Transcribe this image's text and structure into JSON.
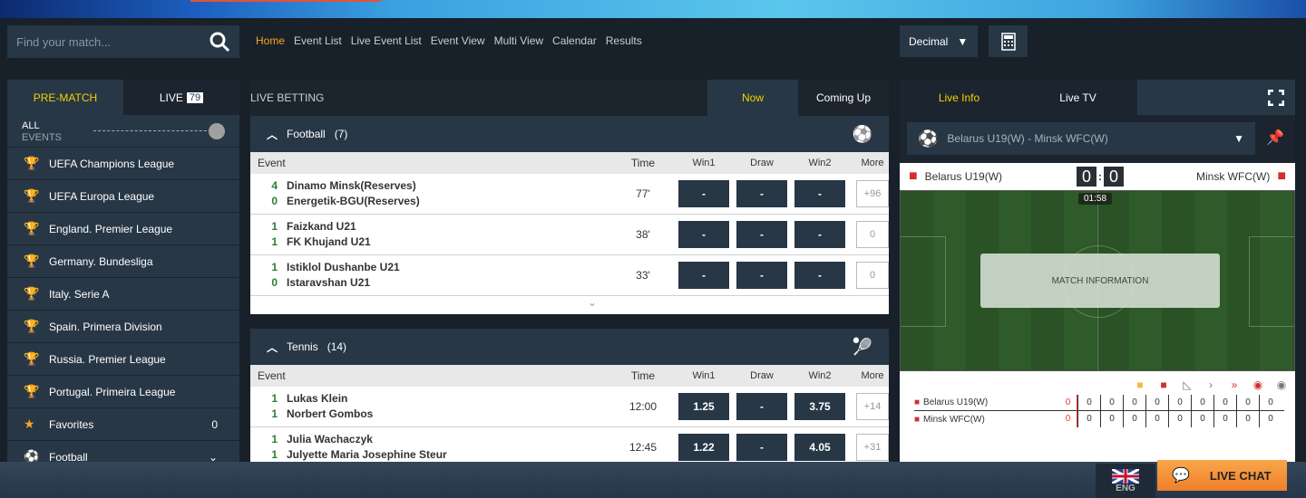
{
  "search": {
    "placeholder": "Find your match..."
  },
  "nav": [
    "Home",
    "Event List",
    "Live Event List",
    "Event View",
    "Multi View",
    "Calendar",
    "Results"
  ],
  "odds_format": "Decimal",
  "sidebar": {
    "tabs": {
      "prematch": "PRE-MATCH",
      "live": "LIVE",
      "live_count": "79"
    },
    "all_events": [
      "ALL",
      "EVENTS"
    ],
    "items": [
      {
        "label": "UEFA Champions League",
        "icon": "trophy-icon"
      },
      {
        "label": "UEFA Europa League",
        "icon": "trophy-icon"
      },
      {
        "label": "England. Premier League",
        "icon": "trophy-icon"
      },
      {
        "label": "Germany. Bundesliga",
        "icon": "trophy-icon"
      },
      {
        "label": "Italy. Serie A",
        "icon": "trophy-icon"
      },
      {
        "label": "Spain. Primera Division",
        "icon": "trophy-icon"
      },
      {
        "label": "Russia. Premier League",
        "icon": "trophy-icon"
      },
      {
        "label": "Portugal. Primeira League",
        "icon": "trophy-icon"
      },
      {
        "label": "Favorites",
        "icon": "star-icon",
        "count": "0"
      },
      {
        "label": "Football",
        "icon": "football-icon"
      }
    ]
  },
  "main": {
    "title": "LIVE BETTING",
    "tabs": [
      "Now",
      "Coming Up"
    ],
    "columns": [
      "Event",
      "Time",
      "Win1",
      "Draw",
      "Win2",
      "More"
    ],
    "sports": [
      {
        "name": "Football",
        "count": "(7)",
        "events": [
          {
            "s1": "4",
            "t1": "Dinamo Minsk(Reserves)",
            "s2": "0",
            "t2": "Energetik-BGU(Reserves)",
            "time": "77'",
            "w1": "-",
            "d": "-",
            "w2": "-",
            "more": "+96"
          },
          {
            "s1": "1",
            "t1": "Faizkand U21",
            "s2": "1",
            "t2": "FK Khujand U21",
            "time": "38'",
            "w1": "-",
            "d": "-",
            "w2": "-",
            "more": "0"
          },
          {
            "s1": "1",
            "t1": "Istiklol Dushanbe U21",
            "s2": "0",
            "t2": "Istaravshan U21",
            "time": "33'",
            "w1": "-",
            "d": "-",
            "w2": "-",
            "more": "0"
          }
        ]
      },
      {
        "name": "Tennis",
        "count": "(14)",
        "events": [
          {
            "s1": "1",
            "t1": "Lukas Klein",
            "s2": "1",
            "t2": "Norbert Gombos",
            "time": "12:00",
            "w1": "1.25",
            "d": "-",
            "w2": "3.75",
            "more": "+14"
          },
          {
            "s1": "1",
            "t1": "Julia Wachaczyk",
            "s2": "1",
            "t2": "Julyette Maria Josephine Steur",
            "time": "12:45",
            "w1": "1.22",
            "d": "-",
            "w2": "4.05",
            "more": "+31"
          }
        ]
      }
    ]
  },
  "right": {
    "tabs": [
      "Live Info",
      "Live TV"
    ],
    "match": "Belarus U19(W) - Minsk WFC(W)",
    "home": "Belarus U19(W)",
    "away": "Minsk WFC(W)",
    "home_score": "0",
    "away_score": "0",
    "clock": "01:58",
    "match_info": "MATCH INFORMATION",
    "stats": [
      {
        "team": "Belarus U19(W)",
        "values": [
          "0",
          "0",
          "0",
          "0",
          "0",
          "0",
          "0",
          "0",
          "0",
          "0"
        ]
      },
      {
        "team": "Minsk WFC(W)",
        "values": [
          "0",
          "0",
          "0",
          "0",
          "0",
          "0",
          "0",
          "0",
          "0",
          "0"
        ]
      }
    ]
  },
  "footer": {
    "lang": "ENG",
    "chat": "LIVE CHAT"
  },
  "colors": {
    "accent": "#f2d100",
    "nav_active": "#f5a623",
    "chat": "#f39035"
  }
}
